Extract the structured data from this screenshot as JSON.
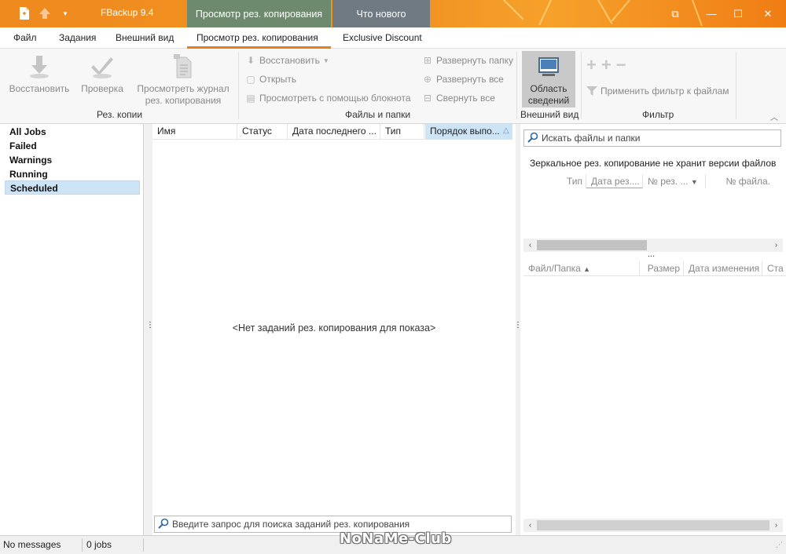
{
  "titlebar": {
    "app_title": "FBackup 9.4",
    "context_tab_1": "Просмотр рез. копирования",
    "context_tab_2": "Что нового",
    "minimize": "—",
    "restore": "☐",
    "close": "✕",
    "ribbon_toggle": "⧉"
  },
  "ribbon_tabs": [
    "Файл",
    "Задания",
    "Внешний вид",
    "Просмотр рез. копирования",
    "Exclusive Discount"
  ],
  "ribbon": {
    "backups_group": {
      "label": "Рез. копии",
      "restore": "Восстановить",
      "verify": "Проверка",
      "view_log_line1": "Просмотреть журнал",
      "view_log_line2": "рез. копирования"
    },
    "files_group": {
      "label": "Файлы и папки",
      "restore": "Восстановить",
      "open": "Открыть",
      "view_notepad": "Просмотреть с помощью блокнота",
      "expand_folder": "Развернуть папку",
      "expand_all": "Развернуть все",
      "collapse_all": "Свернуть все"
    },
    "view_group": {
      "label": "Внешний вид",
      "details_line1": "Область",
      "details_line2": "сведений"
    },
    "filter_group": {
      "label": "Фильтр",
      "apply_filter": "Применить фильтр к файлам"
    }
  },
  "jobs": {
    "items": [
      "All Jobs",
      "Failed",
      "Warnings",
      "Running",
      "Scheduled"
    ],
    "selected": "Scheduled"
  },
  "center": {
    "columns": [
      "Имя",
      "Статус",
      "Дата последнего ...",
      "Тип",
      "Порядок выпо..."
    ],
    "sorted_indicator": "△",
    "empty_message": "<Нет заданий рез. копирования для показа>",
    "search_placeholder": "Введите запрос для поиска заданий рез. копирования"
  },
  "right": {
    "search_placeholder": "Искать файлы и папки",
    "note": "Зеркальное рез. копирование не хранит версии файлов",
    "versions_columns": [
      "Тип",
      "Дата рез....",
      "№ рез. ...",
      "№ файла."
    ],
    "files_columns": [
      "Файл/Папка",
      "Размер",
      "Дата изменения",
      "Ста"
    ],
    "more": "..."
  },
  "statusbar": {
    "messages": "No messages",
    "jobs": "0 jobs"
  },
  "watermark": "NoNaMe-Club",
  "colors": {
    "title_orange": "#ef8a1e",
    "context_tab_green": "#6e8a6e",
    "context_tab_gray": "#6f7a82",
    "accent_underline": "#e47f1c",
    "selection_blue": "#cde4f7"
  }
}
